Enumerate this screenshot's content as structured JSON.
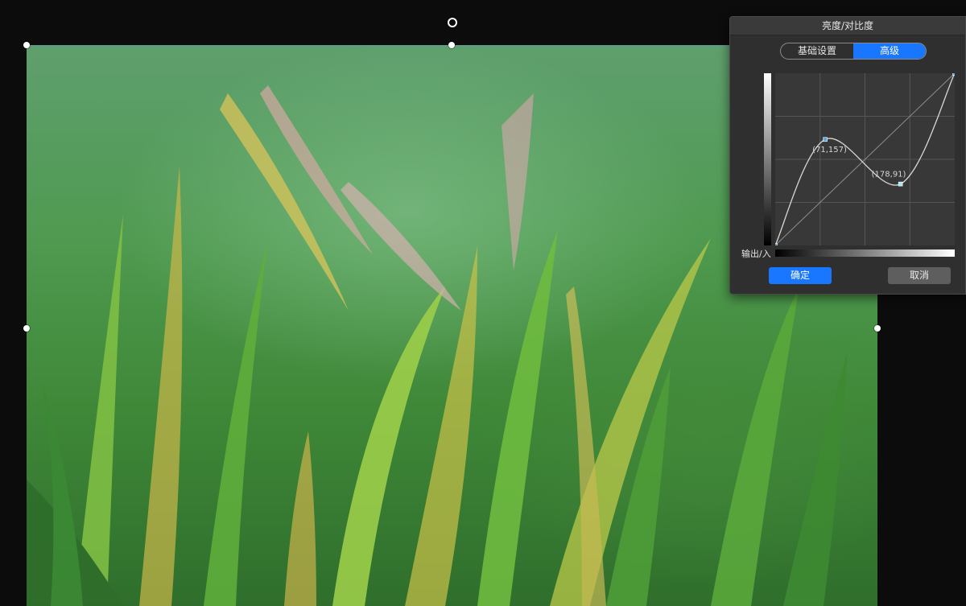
{
  "dialog": {
    "title": "亮度/对比度",
    "tabs": [
      {
        "label": "基础设置",
        "active": false
      },
      {
        "label": "高级",
        "active": true
      }
    ],
    "axis_label": "输出/入",
    "ok_label": "确定",
    "cancel_label": "取消"
  },
  "curve": {
    "range": [
      0,
      255
    ],
    "points": [
      {
        "input": 0,
        "output": 0,
        "label": ""
      },
      {
        "input": 71,
        "output": 157,
        "label": "(71,157)"
      },
      {
        "input": 178,
        "output": 91,
        "label": "(178,91)"
      },
      {
        "input": 255,
        "output": 255,
        "label": ""
      }
    ]
  },
  "colors": {
    "accent": "#1976ff",
    "dialog_bg": "#2f2f2f",
    "canvas_bg": "#0c0c0c"
  }
}
